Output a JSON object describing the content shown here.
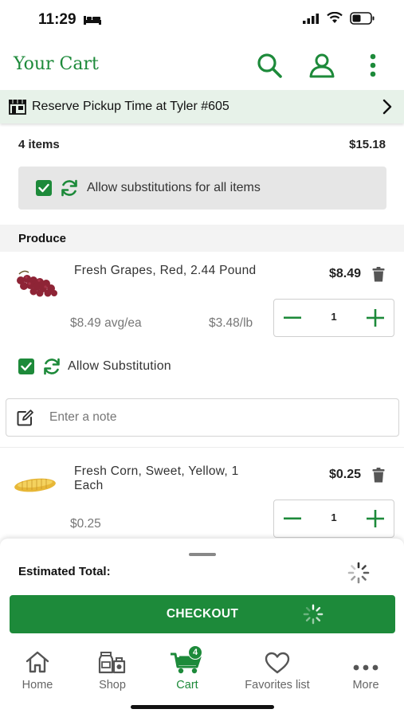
{
  "status_bar": {
    "time": "11:29"
  },
  "header": {
    "title": "Your Cart"
  },
  "pickup": {
    "label": "Reserve Pickup Time at Tyler #605"
  },
  "summary": {
    "items_count": "4 items",
    "total": "$15.18"
  },
  "substitutions": {
    "all_label": "Allow substitutions for all items"
  },
  "section": {
    "title": "Produce"
  },
  "products": [
    {
      "name": "Fresh Grapes, Red, 2.44 Pound",
      "price": "$8.49",
      "sub_price": "$8.49 avg/ea",
      "unit_price": "$3.48/lb",
      "quantity": "1",
      "substitution_label": "Allow Substitution",
      "note_placeholder": "Enter a note"
    },
    {
      "name": "Fresh Corn, Sweet, Yellow, 1 Each",
      "price": "$0.25",
      "sub_price": "$0.25",
      "quantity": "1"
    }
  ],
  "footer": {
    "estimated_total_label": "Estimated Total:",
    "checkout_label": "CHECKOUT"
  },
  "nav": {
    "items": [
      {
        "label": "Home",
        "icon": "home-icon"
      },
      {
        "label": "Shop",
        "icon": "shop-icon"
      },
      {
        "label": "Cart",
        "icon": "cart-icon",
        "badge": "4",
        "active": true
      },
      {
        "label": "Favorites list",
        "icon": "heart-icon"
      },
      {
        "label": "More",
        "icon": "more-dots-icon"
      }
    ]
  },
  "colors": {
    "brand_green": "#1d8a3a",
    "pickup_bg": "#e7f2e9",
    "section_bg": "#f3f3f3"
  }
}
